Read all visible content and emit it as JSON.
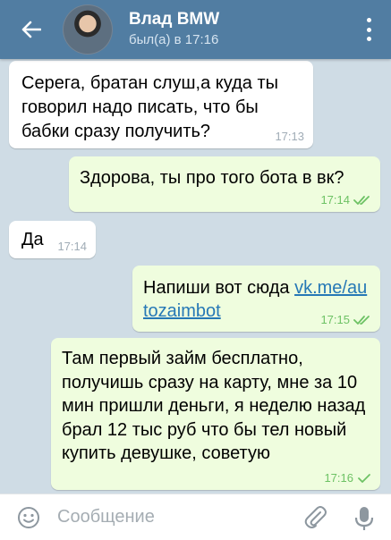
{
  "header": {
    "title": "Влад BMW",
    "status": "был(а) в 17:16"
  },
  "messages": [
    {
      "direction": "in",
      "text": "Серега, братан слуш,а куда ты говорил надо писать, что бы бабки сразу получить?",
      "time": "17:13"
    },
    {
      "direction": "out",
      "text": "Здорова, ты про того бота в вк?",
      "time": "17:14",
      "read": true
    },
    {
      "direction": "in",
      "text": "Да",
      "time": "17:14"
    },
    {
      "direction": "out",
      "text_prefix": "Напиши вот сюда ",
      "link": "vk.me/autozaimbot",
      "time": "17:15",
      "read": true
    },
    {
      "direction": "out",
      "text": "Там первый займ бесплатно, получишь сразу на карту, мне за 10 мин пришли деньги, я неделю назад брал 12 тыс руб что бы тел новый купить девушке, советую",
      "time": "17:16",
      "read": false
    }
  ],
  "composer": {
    "placeholder": "Сообщение"
  },
  "colors": {
    "header": "#517da2",
    "chat_background": "#cfdce5",
    "bubble_in": "#ffffff",
    "bubble_out": "#effdde",
    "check": "#6dc264",
    "link": "#2678b6"
  }
}
